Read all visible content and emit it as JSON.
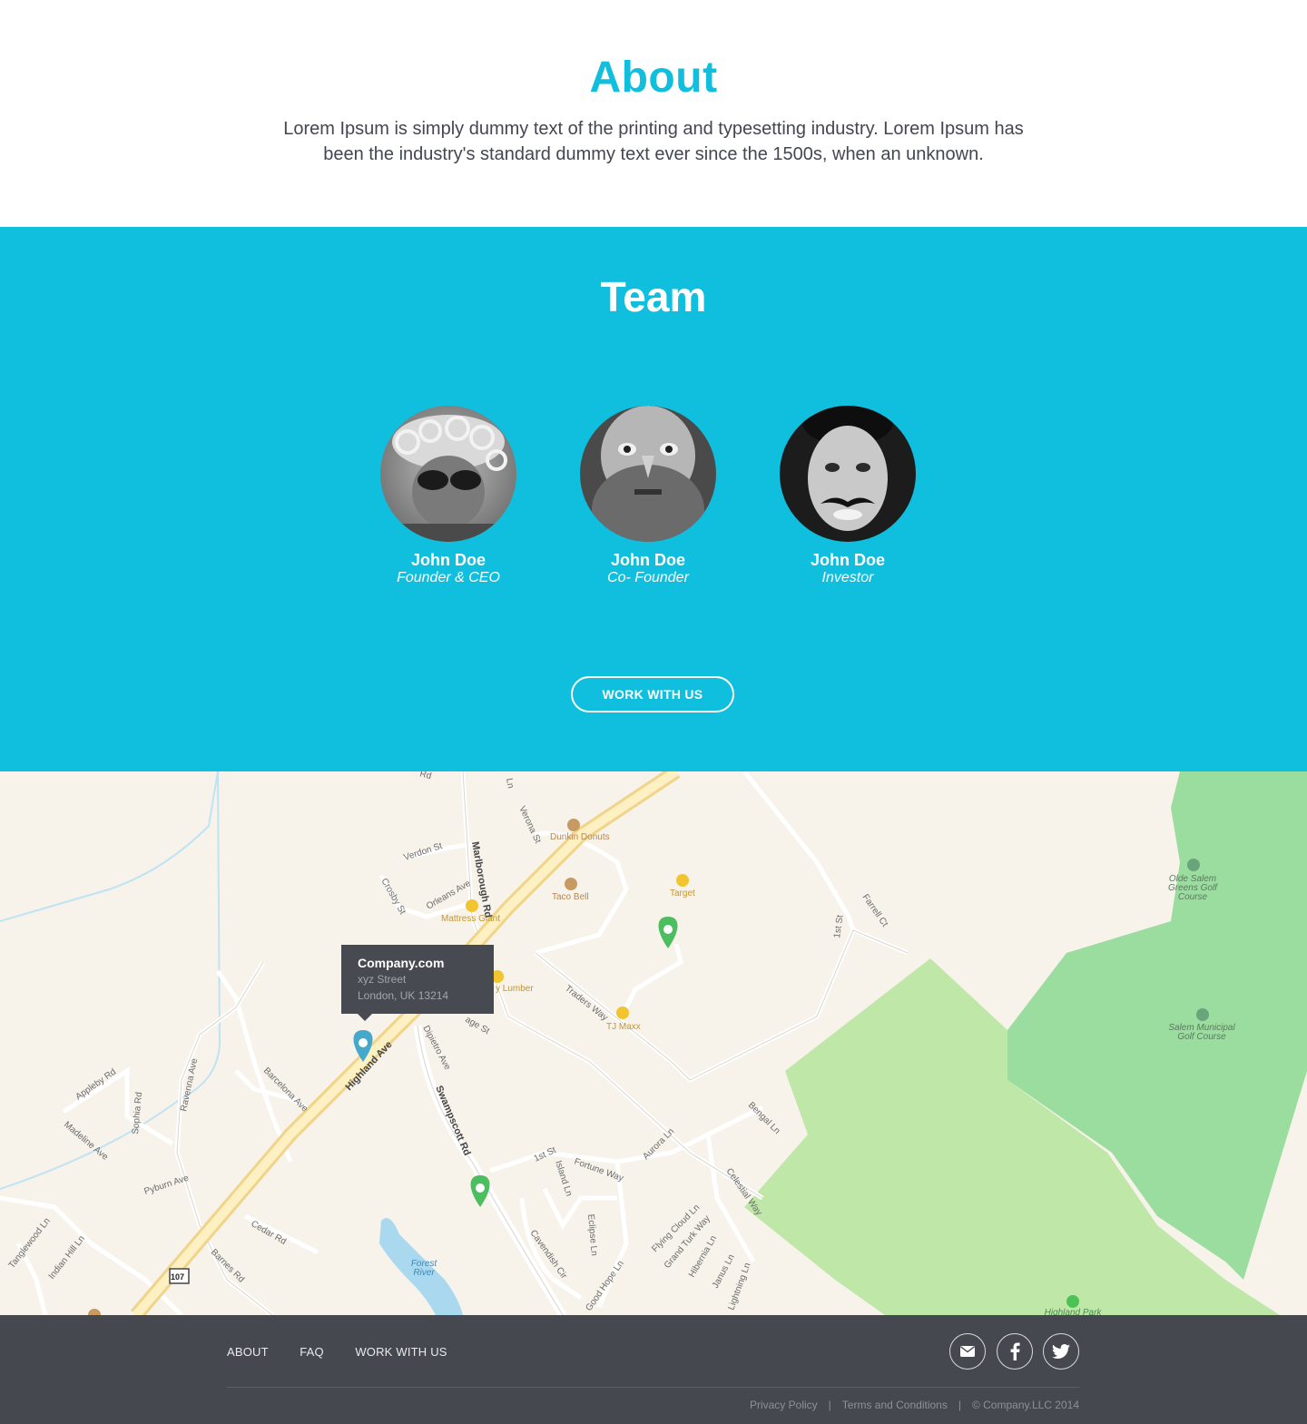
{
  "about": {
    "title": "About",
    "text": "Lorem Ipsum is simply dummy text of the printing and typesetting industry. Lorem Ipsum has been the industry's standard dummy text ever since the 1500s, when an unknown."
  },
  "team": {
    "title": "Team",
    "members": [
      {
        "name": "John Doe",
        "role": "Founder & CEO"
      },
      {
        "name": "John Doe",
        "role": "Co- Founder"
      },
      {
        "name": "John Doe",
        "role": "Investor"
      }
    ],
    "cta": "WORK WITH US"
  },
  "map": {
    "tooltip": {
      "title": "Company.com",
      "line1": "xyz Street",
      "line2": "London, UK 13214"
    },
    "labels": {
      "highland": "Highland Ave",
      "marlborough": "Marlborough Rd",
      "swampscott": "Swampscott Rd",
      "dunkin": "Dunkin Donuts",
      "tacobell": "Taco Bell",
      "target": "Target",
      "mattress": "Mattress Giant",
      "lumber": "y Lumber",
      "tjmaxx": "TJ Maxx",
      "olde1": "Olde Salem",
      "olde2": "Greens Golf",
      "olde3": "Course",
      "salem1": "Salem Municipal",
      "salem2": "Golf Course",
      "forest1": "Forest",
      "forest2": "River",
      "highlandpark": "Highland Park",
      "verdon": "Verdon St",
      "orleans": "Orleans Ave",
      "crosby": "Crosby St",
      "verona": "Verona St",
      "traders": "Traders Way",
      "dipietro": "Dipietro Ave",
      "barcelona": "Barcelona Ave",
      "appleby": "Appleby Rd",
      "madeline": "Madeline Ave",
      "sophia": "Sophia Rd",
      "ravenna": "Ravenna Ave",
      "pyburn": "Pyburn Ave",
      "cedar": "Cedar Rd",
      "barnes": "Barnes Rd",
      "tanglewood": "Tanglewood Ln",
      "indianhill": "Indian Hill Ln",
      "farrell": "Farrell Ct",
      "first1": "1st St",
      "first2": "1st St",
      "fortune": "Fortune Way",
      "aurora": "Aurora Ln",
      "bengal": "Bengal Ln",
      "celestial": "Celestial Way",
      "island": "Island Ln",
      "eclipse": "Eclipse Ln",
      "cavendish": "Cavendish Cir",
      "goodhope": "Good Hope Ln",
      "flyingcloud": "Flying Cloud Ln",
      "grandturk": "Grand Turk Way",
      "hibernia": "Hibernia Ln",
      "janus": "Janus Ln",
      "lightning": "Lightning Ln",
      "route": "107",
      "rdtop": "Rd",
      "lntop": "Ln",
      "gerage": "age St"
    }
  },
  "footer": {
    "nav": [
      "ABOUT",
      "FAQ",
      "WORK WITH US"
    ],
    "legal": {
      "privacy": "Privacy Policy",
      "sep": "|",
      "terms": "Terms and Conditions",
      "copy": "© Company.LLC 2014"
    }
  }
}
